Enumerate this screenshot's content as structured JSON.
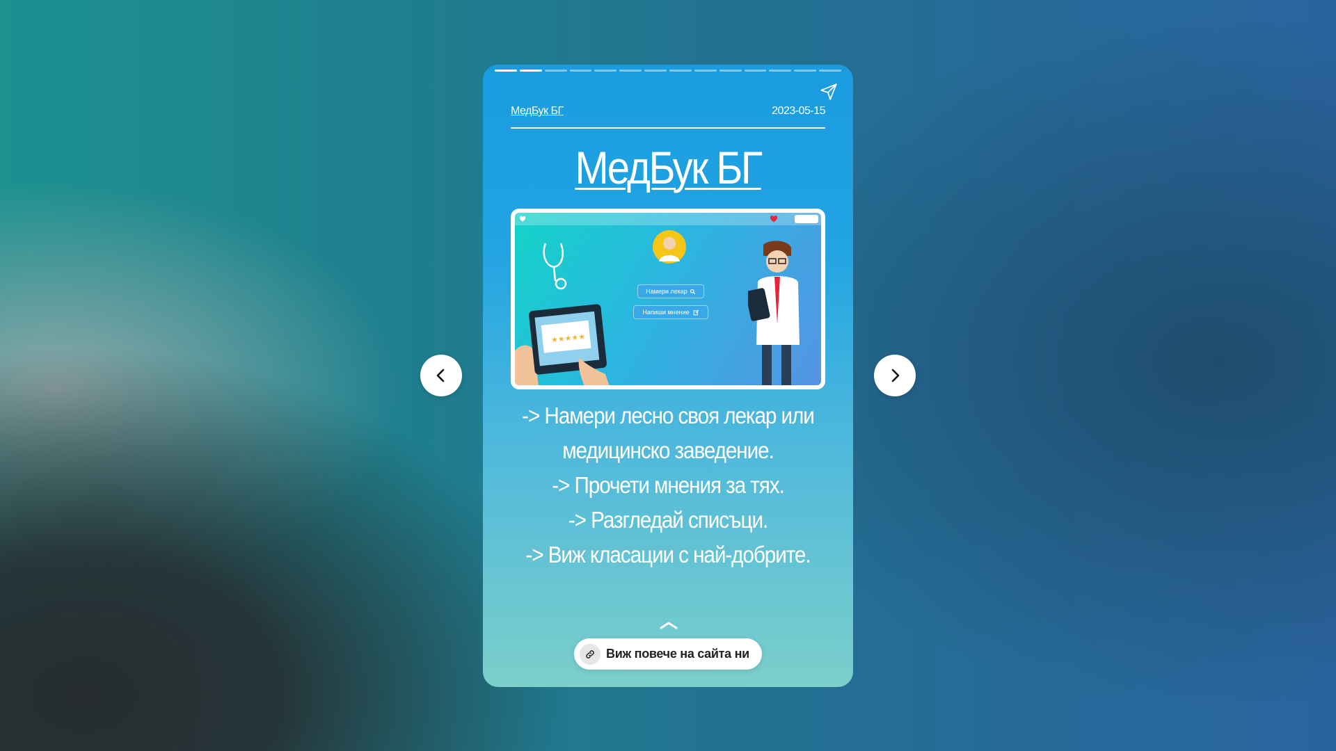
{
  "story": {
    "progress_total": 14,
    "progress_current": 2,
    "author": "МедБук БГ",
    "date": "2023-05-15",
    "title": "МедБук БГ",
    "hero": {
      "find_doctor_button": "Намери лекар",
      "write_review_button": "Напиши мнение"
    },
    "body_lines": [
      "-> Намери лесно своя лекар или медицинско заведение.",
      "-> Прочети мнения за тях.",
      "-> Разгледай списъци.",
      "-> Виж класации с най-добрите."
    ],
    "cta_label": "Виж повече на сайта ни"
  },
  "icons": {
    "prev": "chevron-left-icon",
    "next": "chevron-right-icon",
    "share": "paper-plane-icon",
    "swipe": "chevron-up-icon",
    "link": "link-icon"
  },
  "colors": {
    "story_top": "#1a9be0",
    "story_bottom": "#7ccfcb",
    "text": "#ffffff"
  }
}
